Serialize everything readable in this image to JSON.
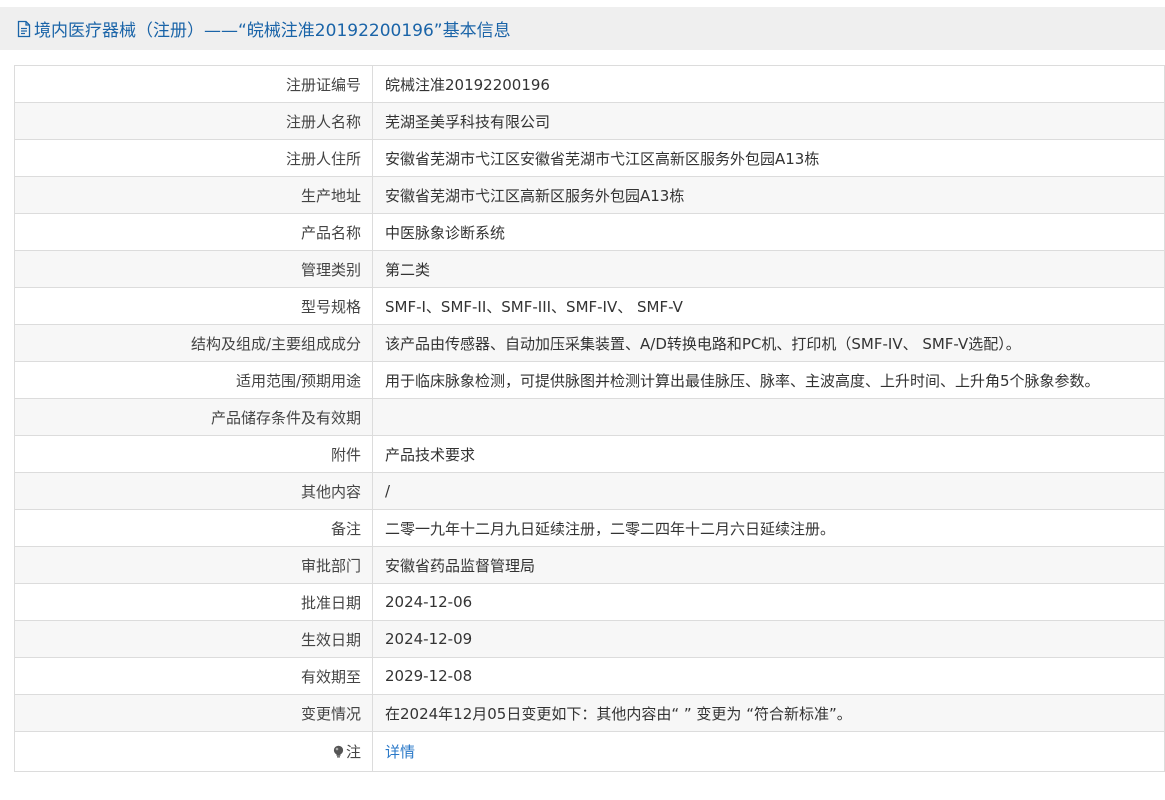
{
  "header": {
    "icon": "document-icon",
    "title": "境内医疗器械（注册）——“皖械注准20192200196”基本信息"
  },
  "rows": [
    {
      "label": "注册证编号",
      "value": "皖械注准20192200196"
    },
    {
      "label": "注册人名称",
      "value": "芜湖圣美孚科技有限公司"
    },
    {
      "label": "注册人住所",
      "value": "安徽省芜湖市弋江区安徽省芜湖市弋江区高新区服务外包园A13栋"
    },
    {
      "label": "生产地址",
      "value": "安徽省芜湖市弋江区高新区服务外包园A13栋"
    },
    {
      "label": "产品名称",
      "value": "中医脉象诊断系统"
    },
    {
      "label": "管理类别",
      "value": "第二类"
    },
    {
      "label": "型号规格",
      "value": "SMF-I、SMF-II、SMF-III、SMF-IV、 SMF-V"
    },
    {
      "label": "结构及组成/主要组成成分",
      "value": "该产品由传感器、自动加压采集装置、A/D转换电路和PC机、打印机（SMF-IV、 SMF-V选配）。"
    },
    {
      "label": "适用范围/预期用途",
      "value": "用于临床脉象检测，可提供脉图并检测计算出最佳脉压、脉率、主波高度、上升时间、上升角5个脉象参数。"
    },
    {
      "label": "产品储存条件及有效期",
      "value": ""
    },
    {
      "label": "附件",
      "value": "产品技术要求"
    },
    {
      "label": "其他内容",
      "value": "/"
    },
    {
      "label": "备注",
      "value": "二零一九年十二月九日延续注册，二零二四年十二月六日延续注册。"
    },
    {
      "label": "审批部门",
      "value": "安徽省药品监督管理局"
    },
    {
      "label": "批准日期",
      "value": "2024-12-06"
    },
    {
      "label": "生效日期",
      "value": "2024-12-09"
    },
    {
      "label": "有效期至",
      "value": "2029-12-08"
    },
    {
      "label": "变更情况",
      "value": "在2024年12月05日变更如下：其他内容由“ ” 变更为 “符合新标准”。"
    }
  ],
  "note_row": {
    "icon": "lightbulb-icon",
    "label": "注",
    "link_label": "详情"
  },
  "colors": {
    "header_bg": "#efefef",
    "header_text": "#1a64a8",
    "link": "#2a78c8",
    "row_alt_bg": "#f7f7f7",
    "border": "#dcdcdc"
  }
}
